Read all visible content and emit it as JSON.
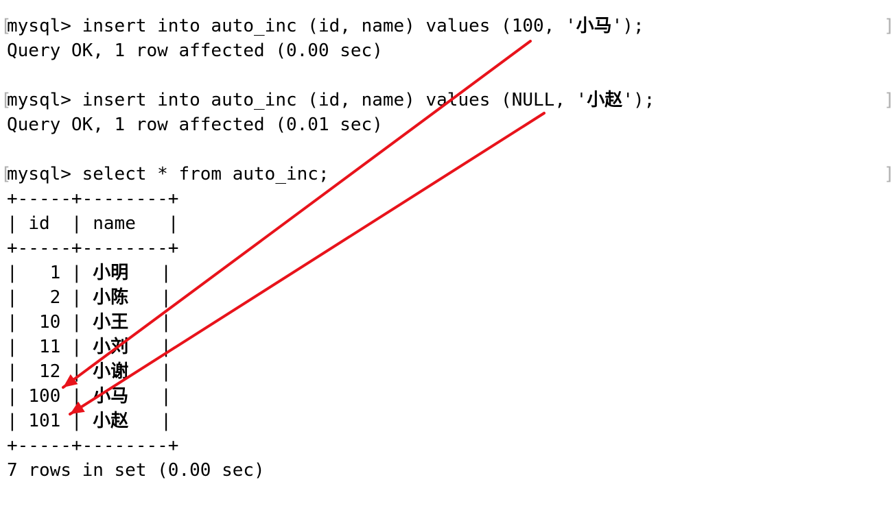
{
  "commands": [
    {
      "prompt": "mysql> ",
      "text_before": "insert into auto_inc (id, name) values (100, '",
      "cjk": "小马",
      "text_after": "');",
      "result": "Query OK, 1 row affected (0.00 sec)"
    },
    {
      "prompt": "mysql> ",
      "text_before": "insert into auto_inc (id, name) values (NULL, '",
      "cjk": "小赵",
      "text_after": "');",
      "result": "Query OK, 1 row affected (0.01 sec)"
    },
    {
      "prompt": "mysql> ",
      "text_before": "select * from auto_inc;",
      "cjk": "",
      "text_after": ""
    }
  ],
  "table": {
    "border": "+-----+--------+",
    "header": {
      "id": "id",
      "name": "name"
    },
    "rows": [
      {
        "id": "1",
        "name": "小明"
      },
      {
        "id": "2",
        "name": "小陈"
      },
      {
        "id": "10",
        "name": "小王"
      },
      {
        "id": "11",
        "name": "小刘"
      },
      {
        "id": "12",
        "name": "小谢"
      },
      {
        "id": "100",
        "name": "小马"
      },
      {
        "id": "101",
        "name": "小赵"
      }
    ],
    "footer": "7 rows in set (0.00 sec)"
  },
  "colors": {
    "arrow": "#e8131b",
    "text": "#000000",
    "bracket": "#b0b0b0"
  }
}
